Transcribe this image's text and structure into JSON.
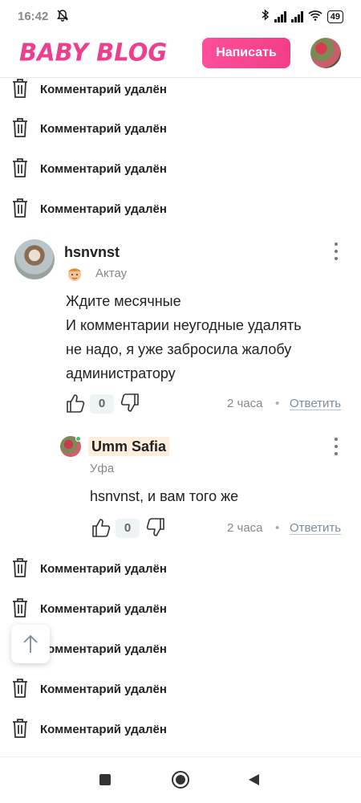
{
  "status_bar": {
    "time": "16:42",
    "battery": "49"
  },
  "header": {
    "logo": "BABY BLOG",
    "write_label": "Написать"
  },
  "deleted_label": "Комментарий удалён",
  "comment_main": {
    "author": "hsnvnst",
    "city": "Актау",
    "text_lines": [
      "Ждите месячные",
      "И комментарии неугодные удалять",
      "не надо, я уже забросила жалобу",
      "администратору"
    ],
    "likes": "0",
    "time": "2 часа",
    "separator": "•",
    "reply_label": "Ответить"
  },
  "comment_reply": {
    "author": "Umm Safia",
    "city": "Уфа",
    "mention": "hsnvnst",
    "text": ", и вам того же",
    "likes": "0",
    "time": "2 часа",
    "separator": "•",
    "reply_label": "Ответить"
  },
  "icons": {
    "trash": "trash-icon",
    "like": "thumbs-up-icon",
    "dislike": "thumbs-down-icon",
    "more": "more-vertical-icon",
    "scroll_top": "arrow-up-icon"
  },
  "colors": {
    "brand": "#ee3f8f",
    "online": "#3cc46a"
  }
}
